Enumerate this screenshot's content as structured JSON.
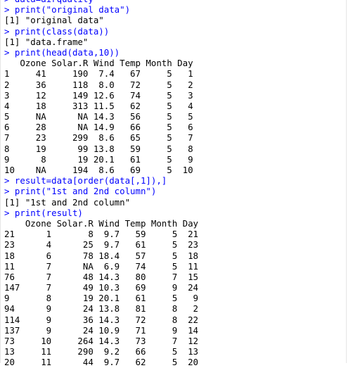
{
  "console": {
    "lines": [
      {
        "type": "cmd",
        "text": "> data=airquality"
      },
      {
        "type": "cmd",
        "text": "> print(\"original data\")"
      },
      {
        "type": "out",
        "text": "[1] \"original data\""
      },
      {
        "type": "cmd",
        "text": "> print(class(data))"
      },
      {
        "type": "out",
        "text": "[1] \"data.frame\""
      },
      {
        "type": "cmd",
        "text": "> print(head(data,10))"
      },
      {
        "type": "out",
        "text": "   Ozone Solar.R Wind Temp Month Day"
      },
      {
        "type": "out",
        "text": "1     41     190  7.4   67     5   1"
      },
      {
        "type": "out",
        "text": "2     36     118  8.0   72     5   2"
      },
      {
        "type": "out",
        "text": "3     12     149 12.6   74     5   3"
      },
      {
        "type": "out",
        "text": "4     18     313 11.5   62     5   4"
      },
      {
        "type": "out",
        "text": "5     NA      NA 14.3   56     5   5"
      },
      {
        "type": "out",
        "text": "6     28      NA 14.9   66     5   6"
      },
      {
        "type": "out",
        "text": "7     23     299  8.6   65     5   7"
      },
      {
        "type": "out",
        "text": "8     19      99 13.8   59     5   8"
      },
      {
        "type": "out",
        "text": "9      8      19 20.1   61     5   9"
      },
      {
        "type": "out",
        "text": "10    NA     194  8.6   69     5  10"
      },
      {
        "type": "cmd",
        "text": "> result=data[order(data[,1]),]"
      },
      {
        "type": "cmd",
        "text": "> print(\"1st and 2nd column\")"
      },
      {
        "type": "out",
        "text": "[1] \"1st and 2nd column\""
      },
      {
        "type": "cmd",
        "text": "> print(result)"
      },
      {
        "type": "out",
        "text": "    Ozone Solar.R Wind Temp Month Day"
      },
      {
        "type": "out",
        "text": "21      1       8  9.7   59     5  21"
      },
      {
        "type": "out",
        "text": "23      4      25  9.7   61     5  23"
      },
      {
        "type": "out",
        "text": "18      6      78 18.4   57     5  18"
      },
      {
        "type": "out",
        "text": "11      7      NA  6.9   74     5  11"
      },
      {
        "type": "out",
        "text": "76      7      48 14.3   80     7  15"
      },
      {
        "type": "out",
        "text": "147     7      49 10.3   69     9  24"
      },
      {
        "type": "out",
        "text": "9       8      19 20.1   61     5   9"
      },
      {
        "type": "out",
        "text": "94      9      24 13.8   81     8   2"
      },
      {
        "type": "out",
        "text": "114     9      36 14.3   72     8  22"
      },
      {
        "type": "out",
        "text": "137     9      24 10.9   71     9  14"
      },
      {
        "type": "out",
        "text": "73     10     264 14.3   73     7  12"
      },
      {
        "type": "out",
        "text": "13     11     290  9.2   66     5  13"
      },
      {
        "type": "out",
        "text": "20     11      44  9.7   62     5  20"
      }
    ]
  },
  "colors": {
    "command": "#0000ff",
    "output": "#000000",
    "background": "#ffffff"
  }
}
